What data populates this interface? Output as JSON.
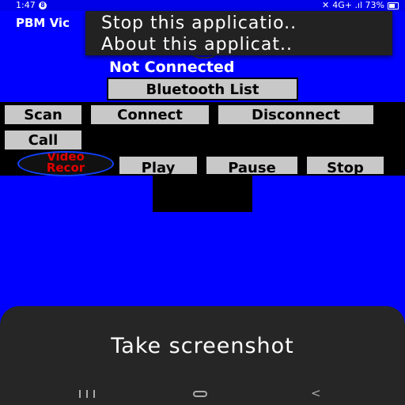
{
  "status_bar": {
    "time": "1:47",
    "notification_badge": "8",
    "right_text": "4G+ .ıl 73%",
    "icons": [
      "mute-icon",
      "signal-icon",
      "battery-icon"
    ]
  },
  "app_bar": {
    "title": "PBM Vic"
  },
  "overflow_menu": {
    "items": [
      {
        "label": "Stop this applicatio.."
      },
      {
        "label": "About this applicat.."
      }
    ]
  },
  "connection": {
    "status": "Not Connected",
    "bluetooth_list_label": "Bluetooth List"
  },
  "controls": {
    "scan_label": "Scan",
    "connect_label": "Connect",
    "disconnect_label": "Disconnect",
    "call_label": "Call",
    "video_record_line1": "Video",
    "video_record_line2": "Recor",
    "play_label": "Play",
    "pause_label": "Pause",
    "stop_label": "Stop"
  },
  "screenshot_sheet": {
    "label": "Take screenshot"
  },
  "colors": {
    "background": "#0000ff",
    "toolbar": "#000000",
    "button": "#c8c8c8",
    "record_text": "#e00000",
    "sheet": "#262626"
  }
}
